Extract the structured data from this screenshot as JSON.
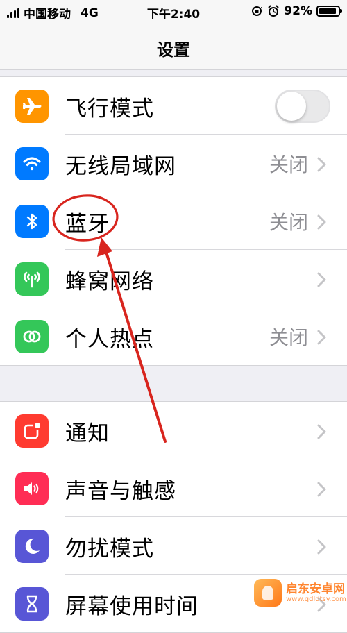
{
  "status_bar": {
    "carrier": "中国移动",
    "network": "4G",
    "time": "下午2:40",
    "battery": "92%",
    "battery_level": 0.92
  },
  "nav": {
    "title": "设置"
  },
  "group1": [
    {
      "label": "飞行模式",
      "icon": "airplane-icon",
      "color": "#ff9500",
      "control": "toggle",
      "toggle_on": false
    },
    {
      "label": "无线局域网",
      "icon": "wifi-icon",
      "color": "#007aff",
      "value": "关闭"
    },
    {
      "label": "蓝牙",
      "icon": "bluetooth-icon",
      "color": "#007aff",
      "value": "关闭"
    },
    {
      "label": "蜂窝网络",
      "icon": "cellular-icon",
      "color": "#34c759",
      "value": ""
    },
    {
      "label": "个人热点",
      "icon": "hotspot-icon",
      "color": "#34c759",
      "value": "关闭"
    }
  ],
  "group2": [
    {
      "label": "通知",
      "icon": "notifications-icon",
      "color": "#ff3b30"
    },
    {
      "label": "声音与触感",
      "icon": "sound-icon",
      "color": "#ff2d55"
    },
    {
      "label": "勿扰模式",
      "icon": "moon-icon",
      "color": "#5856d6"
    },
    {
      "label": "屏幕使用时间",
      "icon": "hourglass-icon",
      "color": "#5856d6"
    }
  ],
  "annotation": {
    "color": "#d8251e",
    "target": "蓝牙"
  },
  "watermark": {
    "title": "启东安卓网",
    "url": "www.qdldtsy.com"
  }
}
